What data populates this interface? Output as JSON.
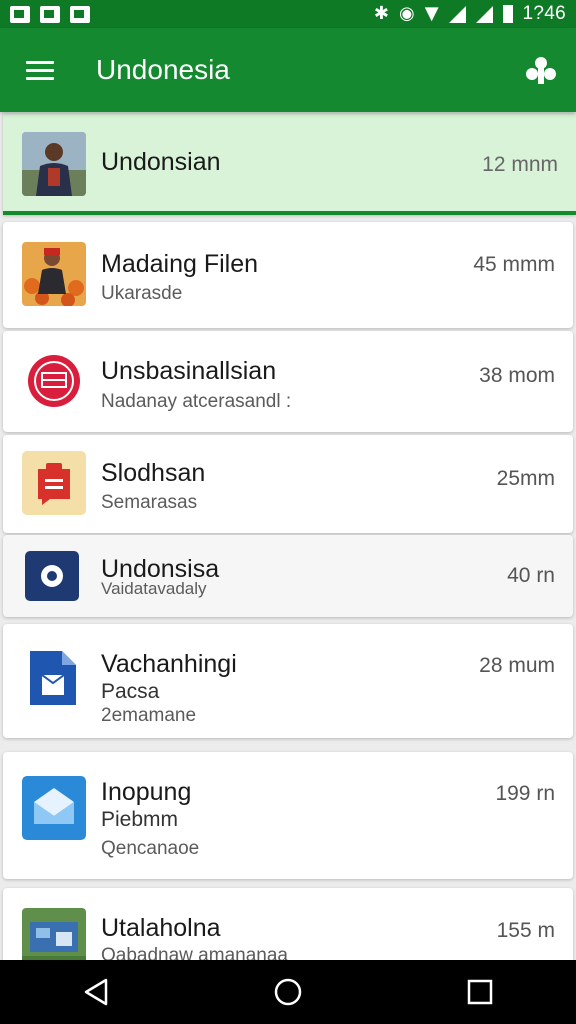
{
  "status_bar": {
    "time": "1?46",
    "icons": [
      "notification-icon",
      "notification-icon",
      "notification-icon",
      "bluetooth-icon",
      "alarm-icon",
      "wifi-icon",
      "signal-icon",
      "signal-icon",
      "battery-icon"
    ]
  },
  "app_bar": {
    "title": "Undonesia",
    "menu_icon": "menu-icon",
    "action_icon": "share-icon",
    "color": "#14892f"
  },
  "list": {
    "items": [
      {
        "title": "Undonsian",
        "time": "12 mnm",
        "thumb": "person-photo",
        "selected": true
      },
      {
        "title": "Madaing Filen",
        "subtitle": "Ukarasde",
        "time": "45 mmm",
        "thumb": "person-photo"
      },
      {
        "title": "Unsbasinallsian",
        "subtitle": "Nadanay atcerasandl :",
        "time": "38 mom",
        "thumb": "seal-logo"
      },
      {
        "title": "Slodhsan",
        "subtitle": "Semarasas",
        "time": "25mm",
        "thumb": "clipboard-icon"
      },
      {
        "title": "Undonsisa",
        "subtitle": "Vaidatavadaly",
        "time": "40 rn",
        "thumb": "camera-icon"
      },
      {
        "title": "Vachanhingi",
        "subtitle": "Pacsa",
        "subtitle2": "2emamane",
        "time": "28 mum",
        "thumb": "document-icon"
      },
      {
        "title": "Inopung",
        "subtitle": "Piebmm",
        "subtitle2": "Qencanaoe",
        "time": "199 rn",
        "thumb": "envelope-icon"
      },
      {
        "title": "Utalaholna",
        "subtitle": "Oabadnaw amananaa",
        "time": "155 m",
        "thumb": "map-photo"
      }
    ]
  },
  "nav_bar": {
    "back_icon": "back-icon",
    "home_icon": "home-icon",
    "recents_icon": "recents-icon"
  }
}
